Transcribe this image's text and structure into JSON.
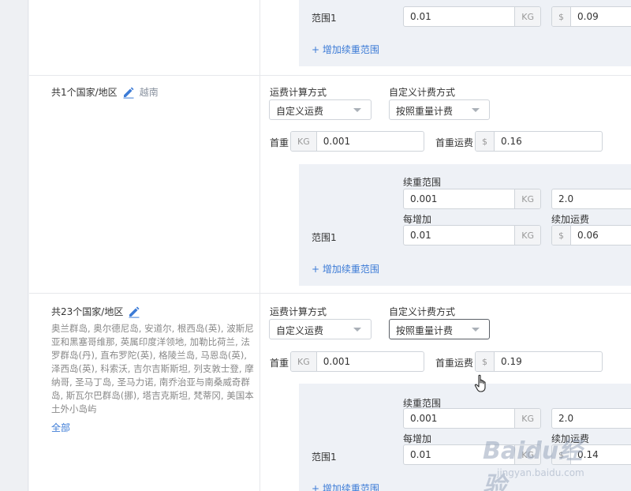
{
  "labels": {
    "calc_method": "运费计算方式",
    "custom_method": "自定义计费方式",
    "first_weight": "首重",
    "first_fee": "首重运费",
    "continue_range": "续重范围",
    "per_increase": "每增加",
    "continue_fee": "续加运费",
    "range_name": "范围1",
    "add_range": "+ 增加续重范围"
  },
  "units": {
    "kg": "KG",
    "usd": "$"
  },
  "row_top": {
    "range_start": "0.01",
    "fee": "0.09"
  },
  "row_vietnam": {
    "title": "共1个国家/地区",
    "country": "越南",
    "calc_method_value": "自定义运费",
    "custom_method_value": "按照重量计费",
    "first_weight": "0.001",
    "first_fee": "0.16",
    "range_start": "0.001",
    "range_end": "2.0",
    "per_increase": "0.01",
    "continue_fee": "0.06"
  },
  "row_23": {
    "title": "共23个国家/地区",
    "countries": "奥兰群岛, 奥尔德尼岛, 安道尔, 根西岛(英), 波斯尼亚和黑塞哥维那, 英属印度洋领地, 加勒比荷兰, 法罗群岛(丹), 直布罗陀(英), 格陵兰岛, 马恩岛(英), 泽西岛(英), 科索沃, 吉尔吉斯斯坦, 列支敦士登, 摩纳哥, 圣马丁岛, 圣马力诺, 南乔治亚与南桑威奇群岛, 斯瓦尔巴群岛(挪), 塔吉克斯坦, 梵蒂冈, 美国本土外小岛屿",
    "all_link": "全部",
    "calc_method_value": "自定义运费",
    "custom_method_value": "按照重量计费",
    "first_weight": "0.001",
    "first_fee": "0.19",
    "range_start": "0.001",
    "range_end": "2.0",
    "per_increase": "0.01",
    "continue_fee_partial": "0.14"
  },
  "watermark": {
    "brand": "Baidu经验",
    "url": "jingyan.baidu.com"
  }
}
